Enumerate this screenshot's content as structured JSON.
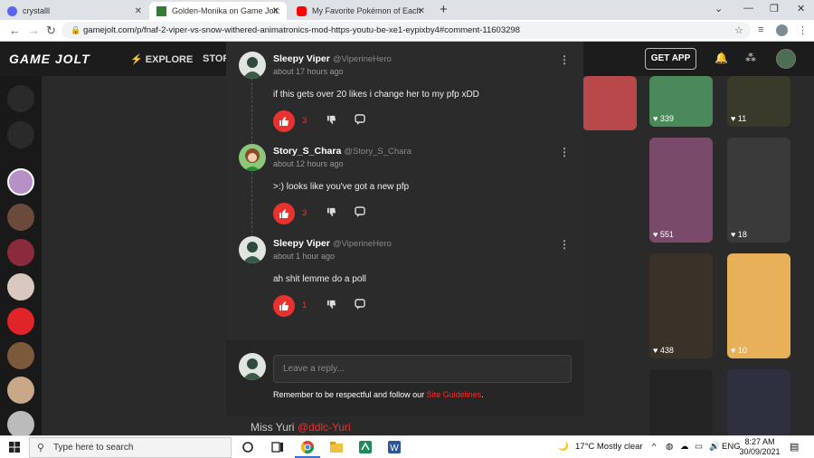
{
  "browser": {
    "tabs": [
      {
        "title": "crystalll",
        "active": false
      },
      {
        "title": "Golden-Monika on Game Jolt: \"F",
        "active": true
      },
      {
        "title": "My Favorite Pokémon of Each Ty",
        "active": false
      }
    ],
    "url": "gamejolt.com/p/fnaf-2-viper-vs-snow-withered-animatronics-mod-https-youtu-be-xe1-eypixby4#comment-11603298"
  },
  "header": {
    "logo": "GAME JOLT",
    "explore": "EXPLORE",
    "store": "STOR",
    "get_app": "GET APP"
  },
  "thumbnails": [
    {
      "stat": "339"
    },
    {
      "stat": "11"
    },
    {
      "stat": "551"
    },
    {
      "stat": "18"
    },
    {
      "stat": "438"
    },
    {
      "stat": "10"
    }
  ],
  "background": {
    "author": "Miss Yuri",
    "mention": "@ddlc-Yuri"
  },
  "comments": [
    {
      "name": "Sleepy Viper",
      "handle": "@ViperineHero",
      "time": "about 17 hours ago",
      "text": "if this gets over 20 likes i change her to my pfp xDD",
      "likes": "3"
    },
    {
      "name": "Story_S_Chara",
      "handle": "@Story_S_Chara",
      "time": "about 12 hours ago",
      "text": ">:) looks like you've got a new pfp",
      "likes": "3"
    },
    {
      "name": "Sleepy Viper",
      "handle": "@ViperineHero",
      "time": "about 1 hour ago",
      "text": "ah shit lemme do a poll",
      "likes": "1"
    }
  ],
  "reply": {
    "placeholder": "Leave a reply...",
    "guidelines_prefix": "Remember to be respectful and follow our",
    "guidelines_link": "Site Guidelines",
    "guidelines_suffix": "."
  },
  "taskbar": {
    "search_placeholder": "Type here to search",
    "weather": "17°C  Mostly clear",
    "lang": "ENG",
    "time": "8:27 AM",
    "date": "30/09/2021"
  },
  "colors": {
    "accent": "#e8322f",
    "modal_bg": "#2b2b2b",
    "header_bg": "#1c1c1c"
  }
}
